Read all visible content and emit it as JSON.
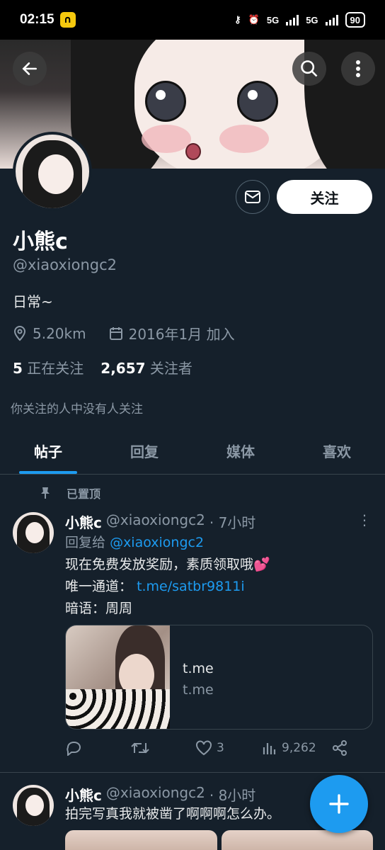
{
  "status_bar": {
    "time": "02:15",
    "network_1": "5G",
    "network_2": "5G",
    "battery": "90"
  },
  "profile": {
    "name": "小熊c",
    "handle": "@xiaoxiongc2",
    "bio": "日常~",
    "location": "5.20km",
    "joined": "2016年1月 加入",
    "following_count": "5",
    "following_label": "正在关注",
    "followers_count": "2,657",
    "followers_label": "关注者",
    "mutual_note": "你关注的人中没有人关注",
    "follow_button": "关注"
  },
  "tabs": [
    "帖子",
    "回复",
    "媒体",
    "喜欢"
  ],
  "pinned_label": "已置顶",
  "tweets": [
    {
      "name": "小熊c",
      "handle": "@xiaoxiongc2",
      "time": "· 7小时",
      "reply_prefix": "回复给",
      "reply_to": "@xiaoxiongc2",
      "line1": "现在免费发放奖励，素质领取哦💕",
      "line2_label": "唯一通道：",
      "line2_link": "t.me/satbr9811i",
      "line3": "暗语：周周",
      "card_title": "t.me",
      "card_domain": "t.me",
      "likes": "3",
      "views": "9,262"
    },
    {
      "name": "小熊c",
      "handle": "@xiaoxiongc2",
      "time": "· 8小时",
      "text": "拍完写真我就被凿了啊啊啊怎么办。"
    }
  ],
  "colors": {
    "accent": "#1d9bf0",
    "background": "#15202b",
    "muted": "#8b98a5"
  }
}
